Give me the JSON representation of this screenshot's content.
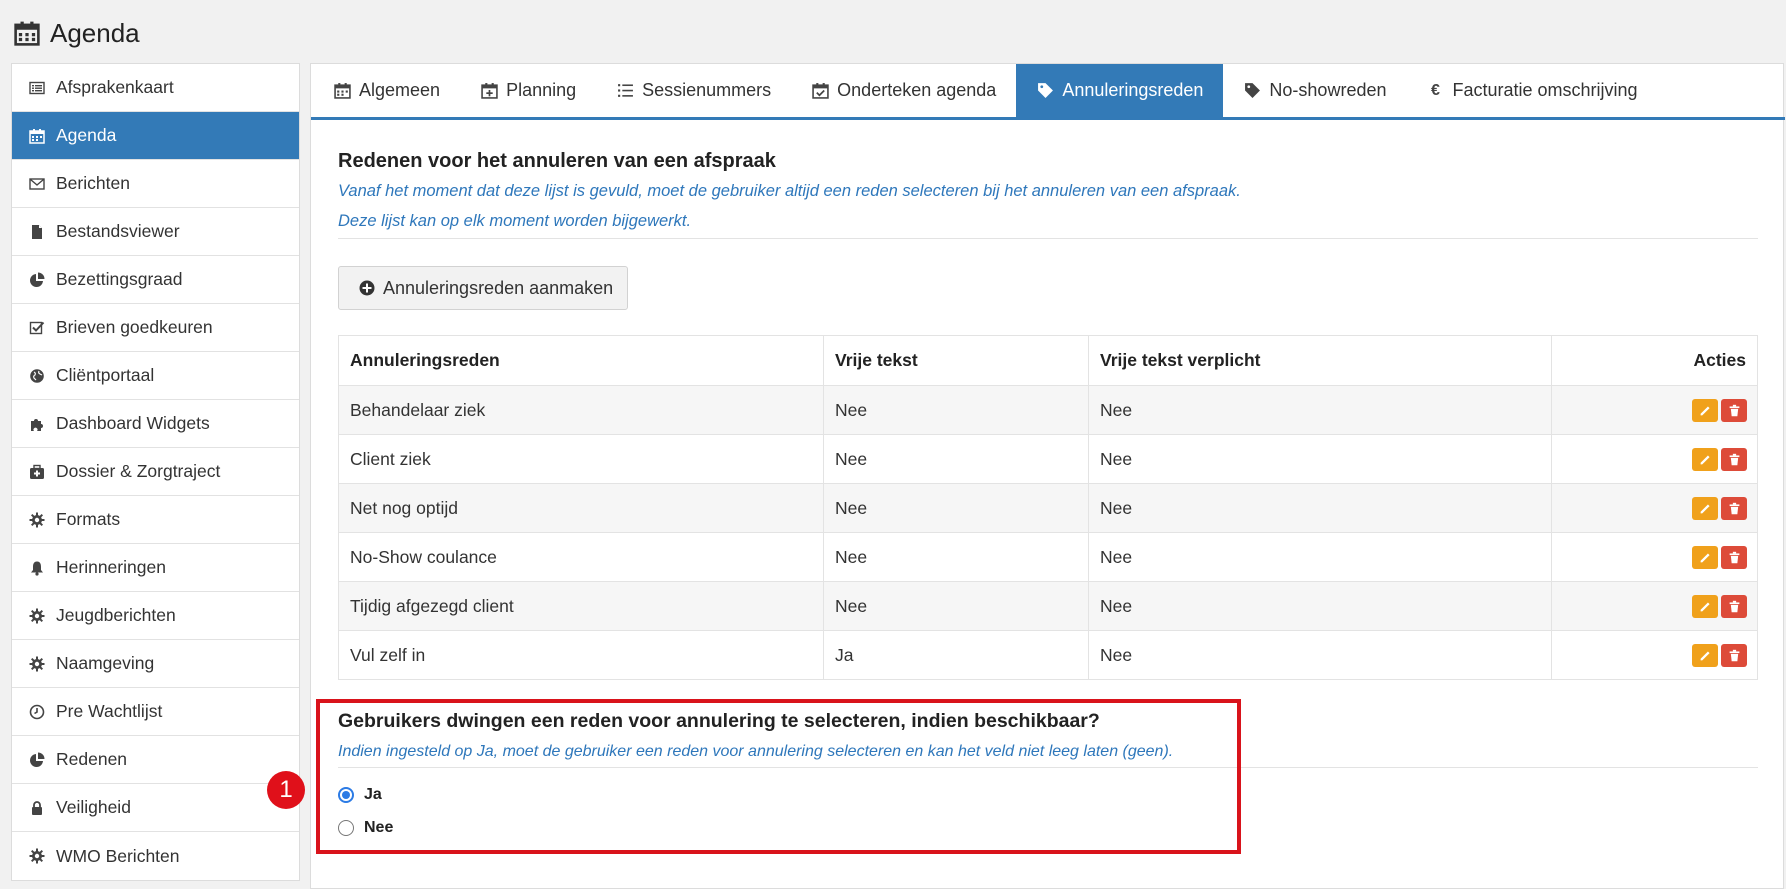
{
  "page": {
    "title": "Agenda",
    "title_icon": "calendar-icon"
  },
  "sidebar": {
    "items": [
      {
        "label": "Afsprakenkaart",
        "icon": "list-alt-icon"
      },
      {
        "label": "Agenda",
        "icon": "calendar-icon",
        "active": true
      },
      {
        "label": "Berichten",
        "icon": "envelope-icon"
      },
      {
        "label": "Bestandsviewer",
        "icon": "file-icon"
      },
      {
        "label": "Bezettingsgraad",
        "icon": "pie-chart-icon"
      },
      {
        "label": "Brieven goedkeuren",
        "icon": "check-square-icon"
      },
      {
        "label": "Cliëntportaal",
        "icon": "globe-icon"
      },
      {
        "label": "Dashboard Widgets",
        "icon": "puzzle-icon"
      },
      {
        "label": "Dossier & Zorgtraject",
        "icon": "medkit-icon"
      },
      {
        "label": "Formats",
        "icon": "gear-icon"
      },
      {
        "label": "Herinneringen",
        "icon": "bell-icon"
      },
      {
        "label": "Jeugdberichten",
        "icon": "gear-icon"
      },
      {
        "label": "Naamgeving",
        "icon": "gear-icon"
      },
      {
        "label": "Pre Wachtlijst",
        "icon": "clock-icon"
      },
      {
        "label": "Redenen",
        "icon": "pie-chart-icon"
      },
      {
        "label": "Veiligheid",
        "icon": "lock-icon"
      },
      {
        "label": "WMO Berichten",
        "icon": "gear-icon"
      }
    ]
  },
  "tabs": [
    {
      "label": "Algemeen",
      "icon": "calendar-icon"
    },
    {
      "label": "Planning",
      "icon": "calendar-plus-icon"
    },
    {
      "label": "Sessienummers",
      "icon": "list-ol-icon"
    },
    {
      "label": "Onderteken agenda",
      "icon": "calendar-check-icon"
    },
    {
      "label": "Annuleringsreden",
      "icon": "tag-icon",
      "active": true
    },
    {
      "label": "No-showreden",
      "icon": "tag-icon"
    },
    {
      "label": "Facturatie omschrijving",
      "icon": "euro-icon"
    }
  ],
  "section1": {
    "title": "Redenen voor het annuleren van een afspraak",
    "hint1": "Vanaf het moment dat deze lijst is gevuld, moet de gebruiker altijd een reden selecteren bij het annuleren van een afspraak.",
    "hint2": "Deze lijst kan op elk moment worden bijgewerkt.",
    "create_button": "Annuleringsreden aanmaken"
  },
  "table": {
    "headers": [
      "Annuleringsreden",
      "Vrije tekst",
      "Vrije tekst verplicht",
      "Acties"
    ],
    "rows": [
      [
        "Behandelaar ziek",
        "Nee",
        "Nee"
      ],
      [
        "Client ziek",
        "Nee",
        "Nee"
      ],
      [
        "Net nog optijd",
        "Nee",
        "Nee"
      ],
      [
        "No-Show coulance",
        "Nee",
        "Nee"
      ],
      [
        "Tijdig afgezegd client",
        "Nee",
        "Nee"
      ],
      [
        "Vul zelf in",
        "Ja",
        "Nee"
      ]
    ]
  },
  "section2": {
    "title": "Gebruikers dwingen een reden voor annulering te selecteren, indien beschikbaar?",
    "hint": "Indien ingesteld op Ja, moet de gebruiker een reden voor annulering selecteren en kan het veld niet leeg laten (geen).",
    "options": [
      "Ja",
      "Nee"
    ],
    "selected": "Ja"
  },
  "annotation": {
    "marker": "1"
  },
  "colors": {
    "primary": "#337ab7",
    "edit": "#f0a11b",
    "delete": "#dd4b39",
    "highlight": "#d9131b",
    "hint": "#2e77bb"
  }
}
